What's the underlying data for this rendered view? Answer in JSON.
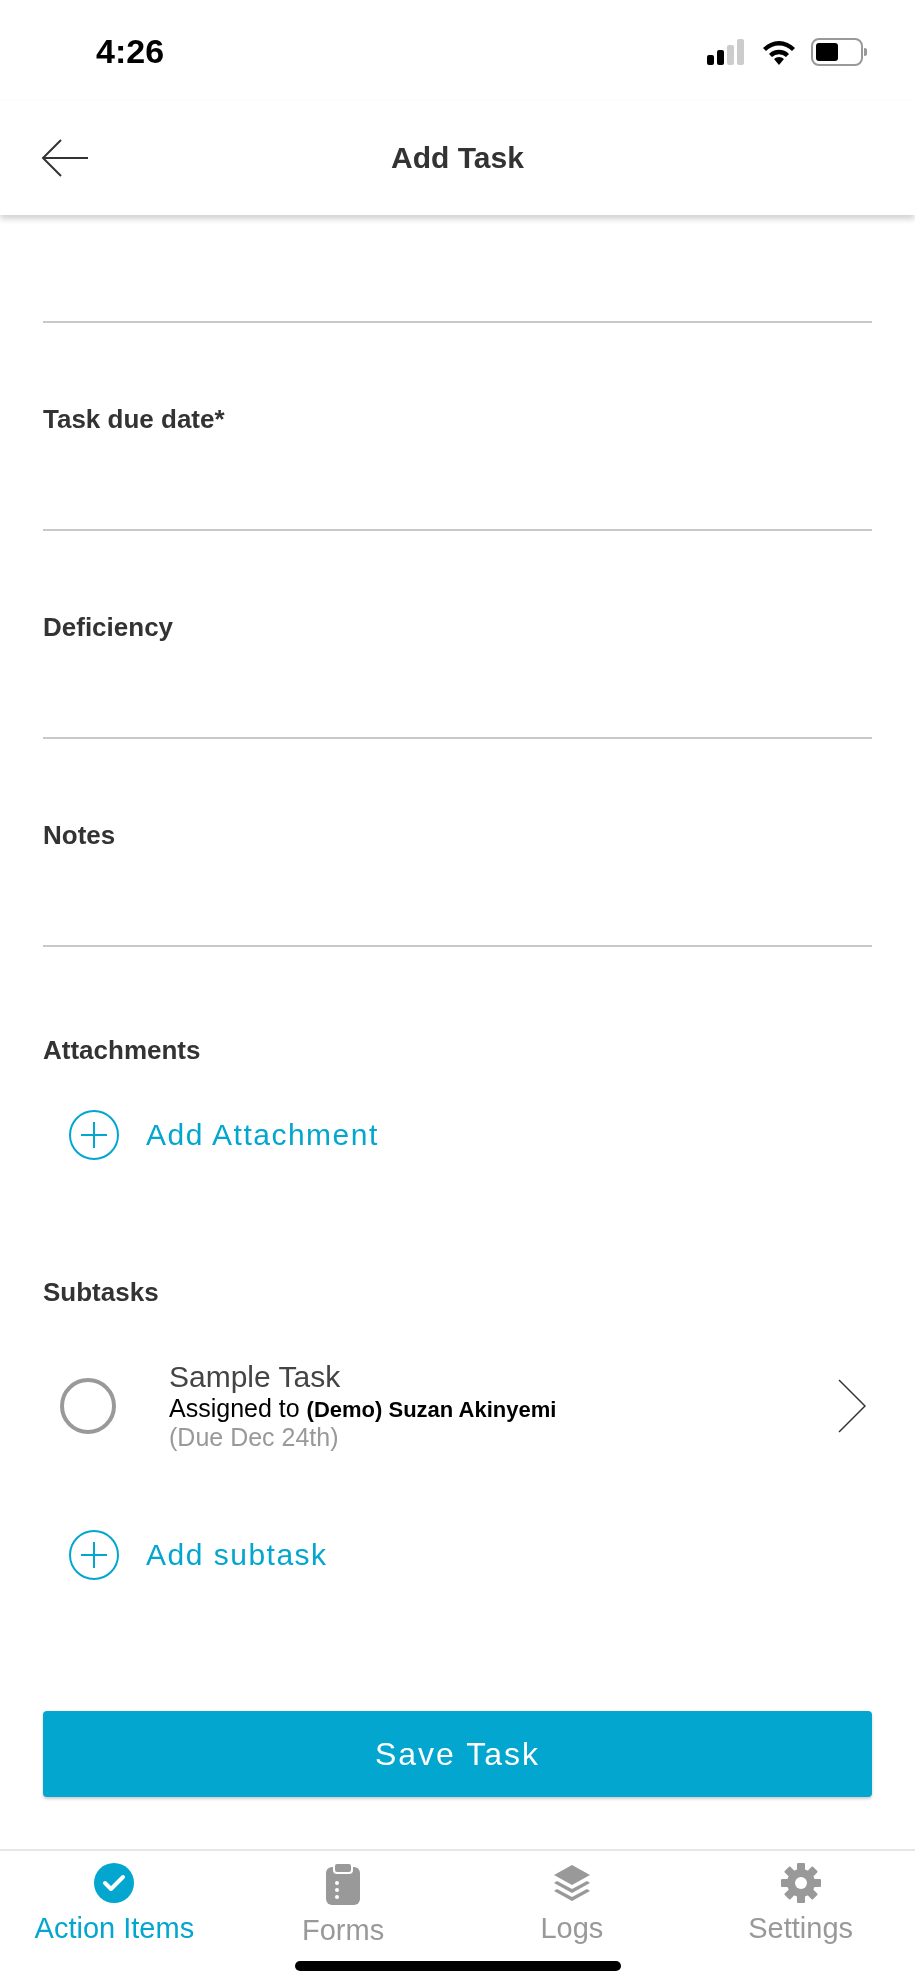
{
  "status_bar": {
    "time": "4:26"
  },
  "header": {
    "title": "Add Task"
  },
  "fields": [
    {
      "label": "Task due date*"
    },
    {
      "label": "Deficiency"
    },
    {
      "label": "Notes"
    }
  ],
  "attachments": {
    "label": "Attachments",
    "add_button": "Add Attachment"
  },
  "subtasks": {
    "label": "Subtasks",
    "items": [
      {
        "title": "Sample Task",
        "assigned": "Assigned to **(Demo) Suzan Akinyemi**",
        "due": "(Due Dec 24th)",
        "checked": false
      }
    ],
    "add_button": "Add subtask"
  },
  "save_button": "Save Task",
  "tab_bar": [
    {
      "kind": "check",
      "label": "Action Items",
      "selected": true
    },
    {
      "kind": "clipboard",
      "label": "Forms",
      "selected": false
    },
    {
      "kind": "layers",
      "label": "Logs",
      "selected": false
    },
    {
      "kind": "gear",
      "label": "Settings",
      "selected": false
    }
  ]
}
